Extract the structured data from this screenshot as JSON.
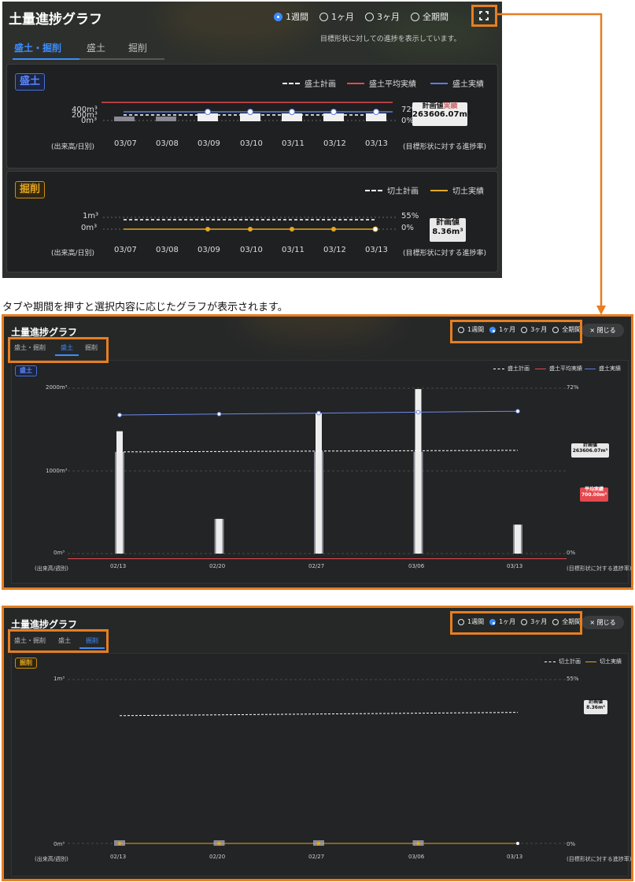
{
  "top_panel": {
    "title": "土量進捗グラフ",
    "periods": [
      "1週間",
      "1ヶ月",
      "3ヶ月",
      "全期間"
    ],
    "selected_period": "1週間",
    "note": "目標形状に対しての進捗を表示しています。",
    "tabs": [
      "盛土・掘削",
      "盛土",
      "掘削"
    ],
    "selected_tab": "盛土・掘削",
    "fill_card": {
      "badge": "盛土",
      "legend": [
        "盛土計画",
        "盛土平均実績",
        "盛土実績"
      ],
      "y_ticks": [
        "400m³",
        "200m³",
        "0m³"
      ],
      "right_ticks": [
        "72%",
        "0%"
      ],
      "x_ticks": [
        "03/07",
        "03/08",
        "03/09",
        "03/10",
        "03/11",
        "03/12",
        "03/13"
      ],
      "left_caption": "(出来高/日別)",
      "right_caption": "(目標形状に対する進捗率)",
      "plan_label": "計画値",
      "plan_value": "263606.07m³",
      "overlap_label": "実績"
    },
    "cut_card": {
      "badge": "掘削",
      "legend": [
        "切土計画",
        "切土実績"
      ],
      "y_ticks": [
        "1m³",
        "0m³"
      ],
      "right_ticks": [
        "55%",
        "0%"
      ],
      "x_ticks": [
        "03/07",
        "03/08",
        "03/09",
        "03/10",
        "03/11",
        "03/12",
        "03/13"
      ],
      "left_caption": "(出来高/日別)",
      "right_caption": "(目標形状に対する進捗率)",
      "plan_label": "計画値",
      "plan_value": "8.36m³"
    }
  },
  "caption": "タブや期間を押すと選択内容に応じたグラフが表示されます。",
  "expanded_fill": {
    "title": "土量進捗グラフ",
    "periods": [
      "1週間",
      "1ヶ月",
      "3ヶ月",
      "全期間"
    ],
    "selected_period": "1ヶ月",
    "close_label": "× 閉じる",
    "tabs": [
      "盛土・掘削",
      "盛土",
      "掘削"
    ],
    "selected_tab": "盛土",
    "badge": "盛土",
    "legend": [
      "盛土計画",
      "盛土平均実績",
      "盛土実績"
    ],
    "y_ticks": [
      "2000m³",
      "1000m³",
      "0m³"
    ],
    "right_ticks": [
      "72%",
      "0%"
    ],
    "x_ticks": [
      "02/13",
      "02/20",
      "02/27",
      "03/06",
      "03/13"
    ],
    "left_caption": "(出来高/週別)",
    "right_caption": "(目標形状に対する進捗率)",
    "plan_label": "計画値",
    "plan_value": "263606.07m³",
    "avg_label": "平均実績",
    "avg_value": "700.00m³"
  },
  "expanded_cut": {
    "title": "土量進捗グラフ",
    "periods": [
      "1週間",
      "1ヶ月",
      "3ヶ月",
      "全期間"
    ],
    "selected_period": "1ヶ月",
    "close_label": "× 閉じる",
    "tabs": [
      "盛土・掘削",
      "盛土",
      "掘削"
    ],
    "selected_tab": "掘削",
    "badge": "掘削",
    "legend": [
      "切土計画",
      "切土実績"
    ],
    "y_ticks": [
      "1m³",
      "0m³"
    ],
    "right_ticks": [
      "55%",
      "0%"
    ],
    "x_ticks": [
      "02/13",
      "02/20",
      "02/27",
      "03/06",
      "03/13"
    ],
    "left_caption": "(出来高/週別)",
    "right_caption": "(目標形状に対する進捗率)",
    "plan_label": "計画値",
    "plan_value": "8.36m³"
  },
  "colors": {
    "accent": "#3b8cff",
    "fill_badge": "#5b86ff",
    "cut_badge": "#e0a321",
    "avg_line": "#e5484d",
    "actual_line": "#5b7ee5",
    "cut_line": "#e3a821",
    "annotation": "#e67e22"
  },
  "chart_data": [
    {
      "type": "bar",
      "title": "",
      "categories": [
        "02/13",
        "02/20",
        "02/27",
        "03/06",
        "03/13"
      ],
      "ylim": [
        0,
        2000
      ],
      "series": [
        {
          "name": "盛土実績",
          "values": [
            1480,
            420,
            1700,
            1990,
            350
          ]
        },
        {
          "name": "盛土計画",
          "values": [
            1230,
            1230,
            1230,
            1230,
            1230
          ]
        },
        {
          "name": "盛土平均実績",
          "values": [
            700,
            700,
            700,
            700,
            700
          ]
        }
      ]
    },
    {
      "type": "line",
      "title": "",
      "categories": [
        "02/13",
        "02/20",
        "02/27",
        "03/06",
        "03/13"
      ],
      "ylim": [
        0,
        1
      ],
      "series": [
        {
          "name": "切土計画",
          "values": [
            0.78,
            0.78,
            0.79,
            0.79,
            0.8
          ]
        },
        {
          "name": "切土実績",
          "values": [
            0,
            0,
            0,
            0,
            0
          ]
        }
      ]
    }
  ]
}
